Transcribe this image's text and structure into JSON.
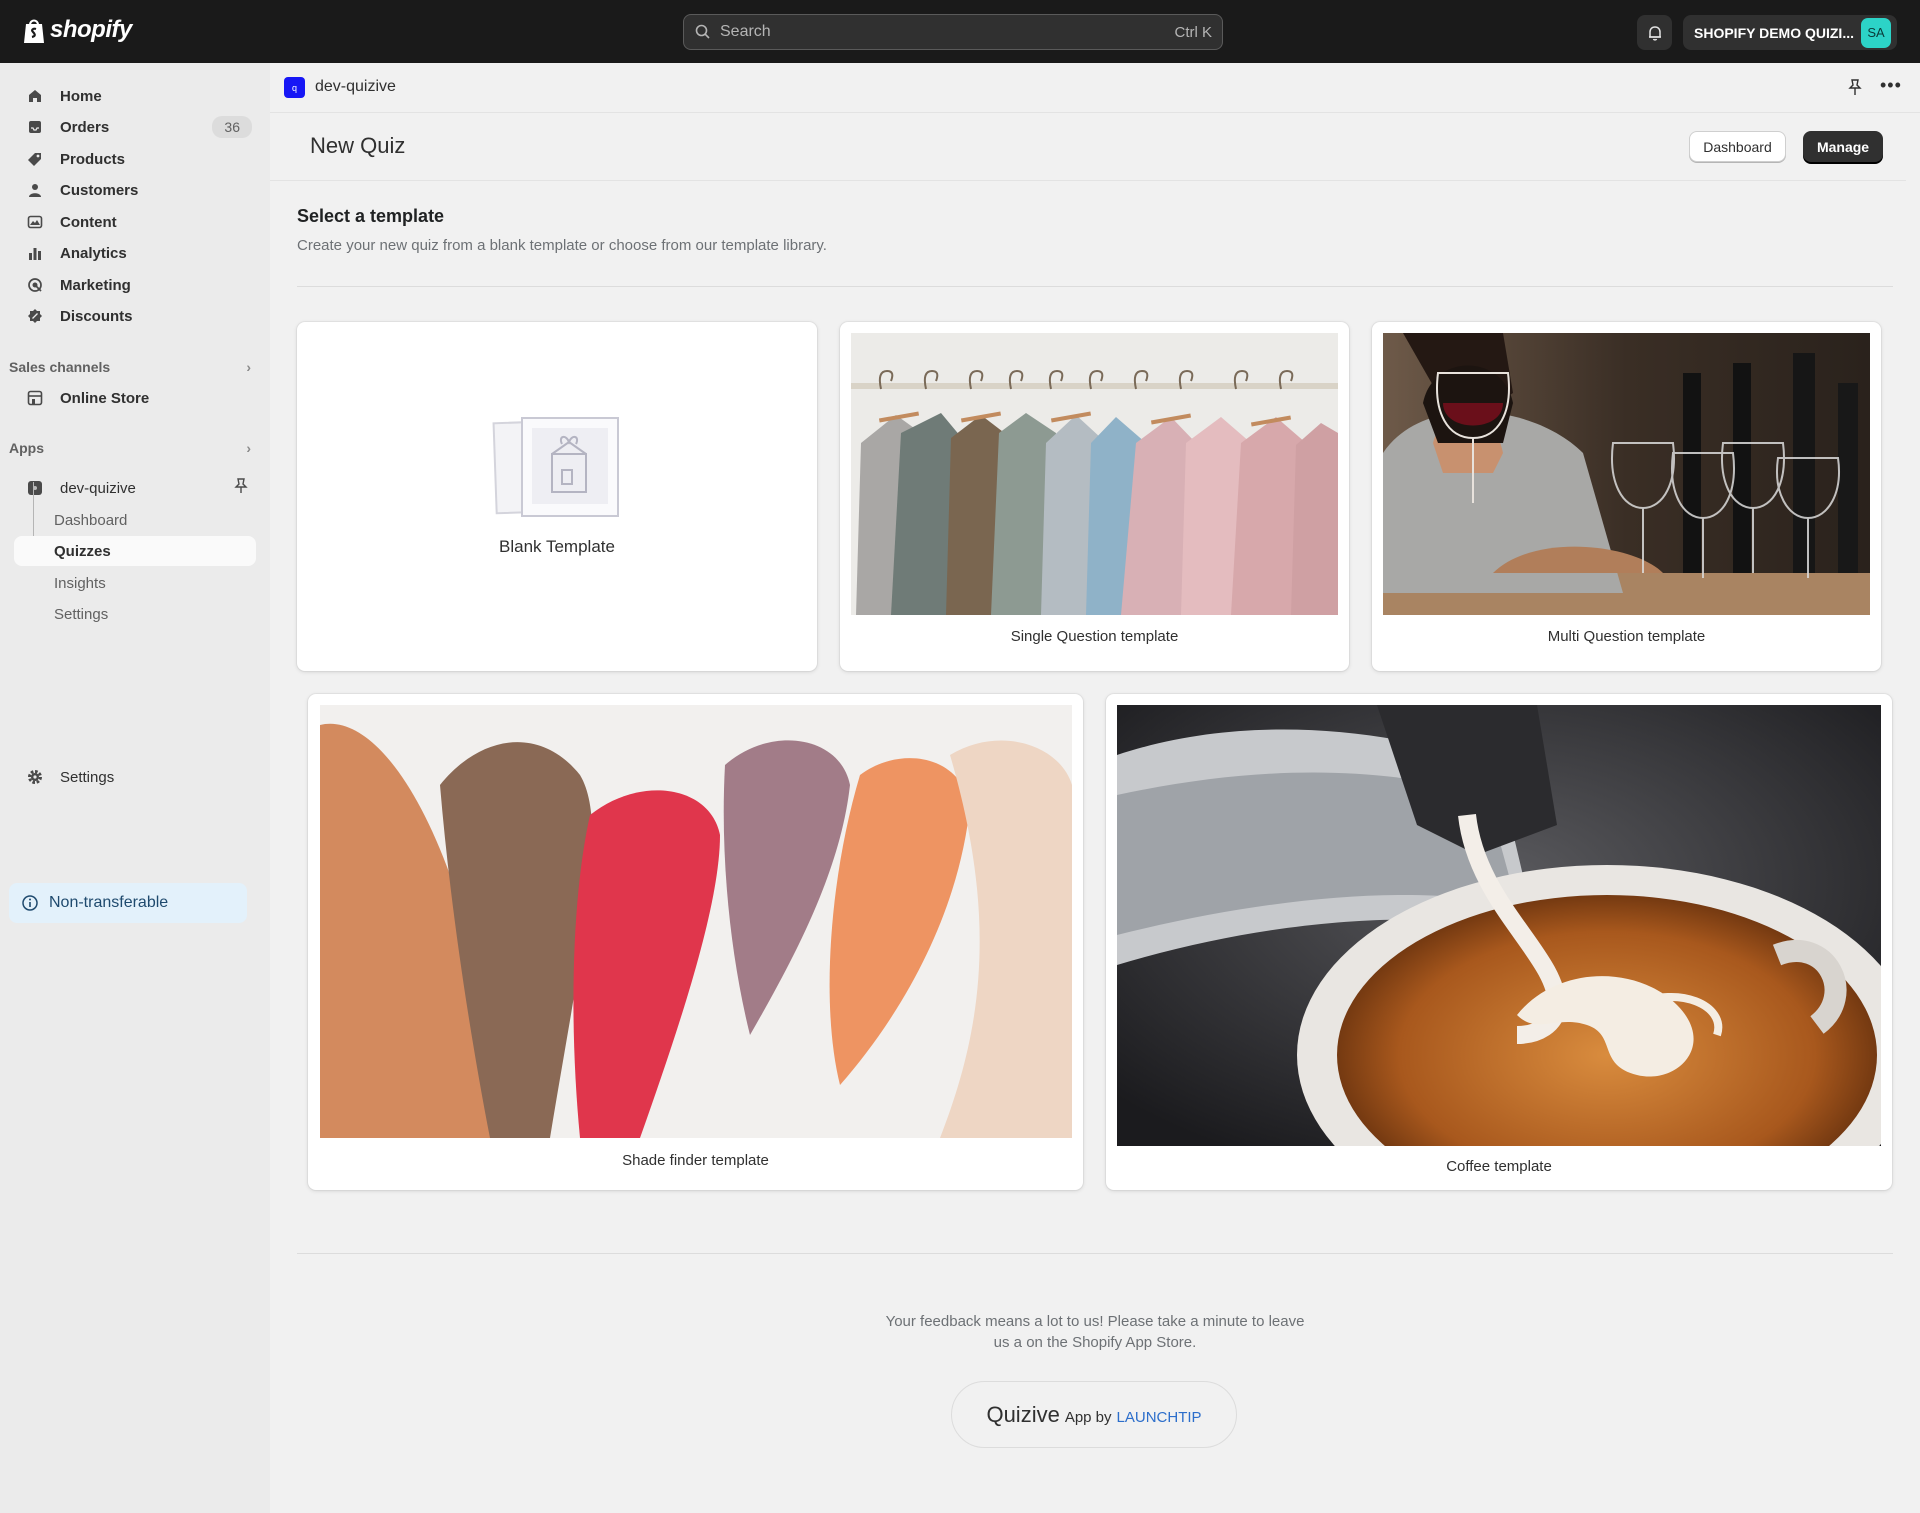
{
  "topbar": {
    "brand": "shopify",
    "search_placeholder": "Search",
    "search_shortcut": "Ctrl K",
    "store_name": "SHOPIFY DEMO QUIZI...",
    "avatar_initials": "SA"
  },
  "sidebar": {
    "items": [
      {
        "label": "Home",
        "icon": "home-icon"
      },
      {
        "label": "Orders",
        "icon": "inbox-icon",
        "count": "36"
      },
      {
        "label": "Products",
        "icon": "tag-icon"
      },
      {
        "label": "Customers",
        "icon": "person-icon"
      },
      {
        "label": "Content",
        "icon": "content-icon"
      },
      {
        "label": "Analytics",
        "icon": "bar-chart-icon"
      },
      {
        "label": "Marketing",
        "icon": "target-icon"
      },
      {
        "label": "Discounts",
        "icon": "discount-icon"
      }
    ],
    "sales_channels_label": "Sales channels",
    "online_store_label": "Online Store",
    "apps_label": "Apps",
    "app_name": "dev-quizive",
    "app_subitems": [
      "Dashboard",
      "Quizzes",
      "Insights",
      "Settings"
    ],
    "settings_label": "Settings",
    "non_transferable_label": "Non-transferable"
  },
  "app_bar": {
    "app_icon_letter": "q",
    "app_name": "dev-quizive"
  },
  "page": {
    "title": "New Quiz",
    "dashboard_button": "Dashboard",
    "manage_button": "Manage",
    "section_title": "Select a template",
    "section_subtitle": "Create your new quiz from a blank template or choose from our template library."
  },
  "templates": [
    {
      "label": "Blank Template"
    },
    {
      "label": "Single Question template"
    },
    {
      "label": "Multi Question template"
    },
    {
      "label": "Shade finder template"
    },
    {
      "label": "Coffee template"
    }
  ],
  "footer": {
    "feedback_line1": "Your feedback means a lot to us! Please take a minute to leave",
    "feedback_line2": "us a on the Shopify App Store.",
    "brand": "Quizive",
    "by_text": "App by",
    "maker": "LAUNCHTIP"
  },
  "colors": {
    "topbar_bg": "#1a1a1a",
    "avatar": "#2cd3c7",
    "app_icon": "#1717f5",
    "maker_link": "#2c6ecb"
  }
}
